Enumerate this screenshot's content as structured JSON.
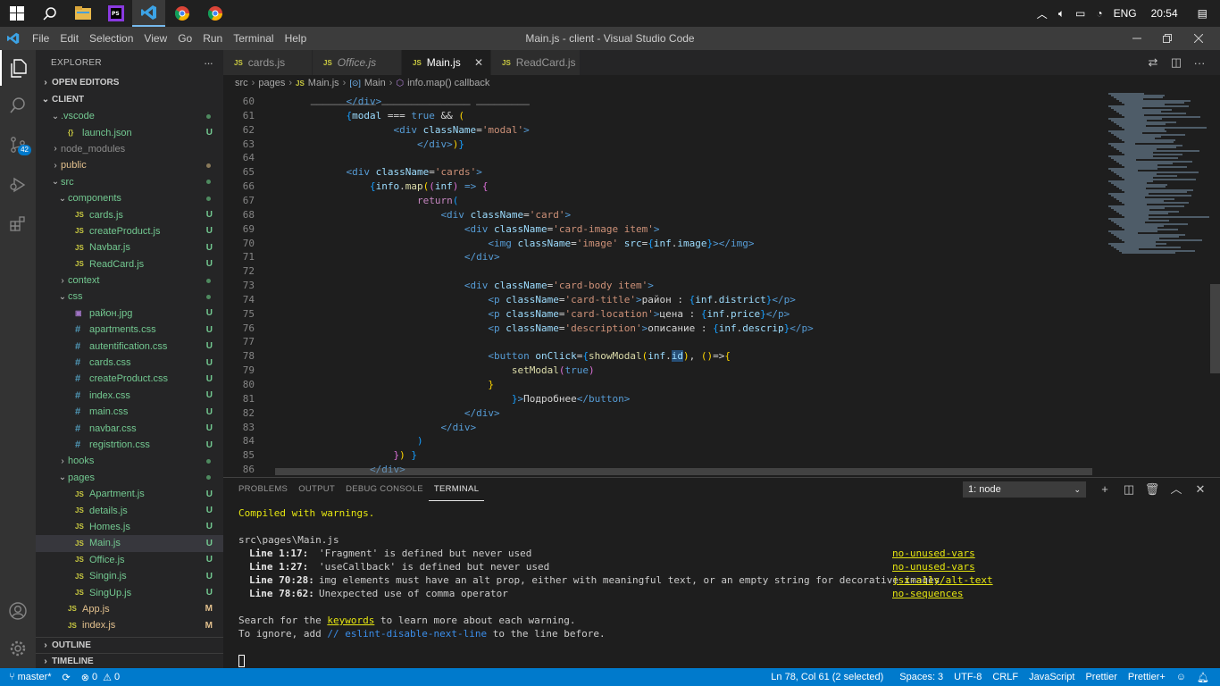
{
  "taskbar": {
    "language": "ENG",
    "time": "20:54"
  },
  "menu": {
    "items": [
      "File",
      "Edit",
      "Selection",
      "View",
      "Go",
      "Run",
      "Terminal",
      "Help"
    ],
    "window_title": "Main.js - client - Visual Studio Code"
  },
  "activity": {
    "scm_badge": "42"
  },
  "sidebar": {
    "title": "EXPLORER",
    "more": "···",
    "open_editors": "OPEN EDITORS",
    "root": "CLIENT",
    "tree": [
      {
        "label": ".vscode",
        "indent": 1,
        "kind": "folder-open",
        "status": "dot-g"
      },
      {
        "label": "launch.json",
        "indent": 2,
        "kind": "json",
        "status": "U"
      },
      {
        "label": "node_modules",
        "indent": 1,
        "kind": "folder",
        "status": ""
      },
      {
        "label": "public",
        "indent": 1,
        "kind": "folder",
        "status": "dot-m"
      },
      {
        "label": "src",
        "indent": 1,
        "kind": "folder-open",
        "status": "dot-g"
      },
      {
        "label": "components",
        "indent": 2,
        "kind": "folder-open",
        "status": "dot-g"
      },
      {
        "label": "cards.js",
        "indent": 3,
        "kind": "js",
        "status": "U"
      },
      {
        "label": "createProduct.js",
        "indent": 3,
        "kind": "js",
        "status": "U"
      },
      {
        "label": "Navbar.js",
        "indent": 3,
        "kind": "js",
        "status": "U"
      },
      {
        "label": "ReadCard.js",
        "indent": 3,
        "kind": "js",
        "status": "U"
      },
      {
        "label": "context",
        "indent": 2,
        "kind": "folder",
        "status": "dot-g"
      },
      {
        "label": "css",
        "indent": 2,
        "kind": "folder-open",
        "status": "dot-g"
      },
      {
        "label": "район.jpg",
        "indent": 3,
        "kind": "img",
        "status": "U"
      },
      {
        "label": "apartments.css",
        "indent": 3,
        "kind": "css",
        "status": "U"
      },
      {
        "label": "autentification.css",
        "indent": 3,
        "kind": "css",
        "status": "U"
      },
      {
        "label": "cards.css",
        "indent": 3,
        "kind": "css",
        "status": "U"
      },
      {
        "label": "createProduct.css",
        "indent": 3,
        "kind": "css",
        "status": "U"
      },
      {
        "label": "index.css",
        "indent": 3,
        "kind": "css",
        "status": "U"
      },
      {
        "label": "main.css",
        "indent": 3,
        "kind": "css",
        "status": "U"
      },
      {
        "label": "navbar.css",
        "indent": 3,
        "kind": "css",
        "status": "U"
      },
      {
        "label": "registrtion.css",
        "indent": 3,
        "kind": "css",
        "status": "U"
      },
      {
        "label": "hooks",
        "indent": 2,
        "kind": "folder",
        "status": "dot-g"
      },
      {
        "label": "pages",
        "indent": 2,
        "kind": "folder-open",
        "status": "dot-g"
      },
      {
        "label": "Apartment.js",
        "indent": 3,
        "kind": "js",
        "status": "U"
      },
      {
        "label": "details.js",
        "indent": 3,
        "kind": "js",
        "status": "U"
      },
      {
        "label": "Homes.js",
        "indent": 3,
        "kind": "js",
        "status": "U"
      },
      {
        "label": "Main.js",
        "indent": 3,
        "kind": "js",
        "status": "U",
        "selected": true
      },
      {
        "label": "Office.js",
        "indent": 3,
        "kind": "js",
        "status": "U"
      },
      {
        "label": "Singin.js",
        "indent": 3,
        "kind": "js",
        "status": "U"
      },
      {
        "label": "SingUp.js",
        "indent": 3,
        "kind": "js",
        "status": "U"
      },
      {
        "label": "App.js",
        "indent": 2,
        "kind": "js",
        "status": "M"
      },
      {
        "label": "index.js",
        "indent": 2,
        "kind": "js",
        "status": "M"
      }
    ],
    "outline": "OUTLINE",
    "timeline": "TIMELINE"
  },
  "tabs": [
    {
      "label": "cards.js",
      "active": false,
      "italic": false
    },
    {
      "label": "Office.js",
      "active": false,
      "italic": true
    },
    {
      "label": "Main.js",
      "active": true,
      "italic": false
    },
    {
      "label": "ReadCard.js",
      "active": false,
      "italic": false
    }
  ],
  "breadcrumb": [
    "src",
    "pages",
    "Main.js",
    "Main",
    "info.map() callback"
  ],
  "editor": {
    "lines": [
      {
        "n": "60",
        "html": "            <span class='tok-tag'>&lt;/div&gt;</span>"
      },
      {
        "n": "61",
        "html": "            <span class='tok-br3'>{</span><span class='tok-attr'>modal</span> === <span class='tok-tag'>true</span> &amp;&amp; <span class='tok-br'>(</span>"
      },
      {
        "n": "62",
        "html": "                    <span class='tok-tag'>&lt;div</span> <span class='tok-attr'>className</span>=<span class='tok-str'>'modal'</span><span class='tok-tag'>&gt;</span>"
      },
      {
        "n": "63",
        "html": "                        <span class='tok-tag'>&lt;/div&gt;</span><span class='tok-br'>)</span><span class='tok-br3'>}</span>"
      },
      {
        "n": "64",
        "html": ""
      },
      {
        "n": "65",
        "html": "            <span class='tok-tag'>&lt;div</span> <span class='tok-attr'>className</span>=<span class='tok-str'>'cards'</span><span class='tok-tag'>&gt;</span>"
      },
      {
        "n": "66",
        "html": "                <span class='tok-br3'>{</span><span class='tok-attr'>info</span>.<span class='tok-fn'>map</span><span class='tok-br'>(</span><span class='tok-br2'>(</span><span class='tok-attr'>inf</span><span class='tok-br2'>)</span> <span class='tok-tag'>=&gt;</span> <span class='tok-br2'>{</span>"
      },
      {
        "n": "67",
        "html": "                        <span class='tok-kw'>return</span><span class='tok-br3'>(</span>"
      },
      {
        "n": "68",
        "html": "                            <span class='tok-tag'>&lt;div</span> <span class='tok-attr'>className</span>=<span class='tok-str'>'card'</span><span class='tok-tag'>&gt;</span>"
      },
      {
        "n": "69",
        "html": "                                <span class='tok-tag'>&lt;div</span> <span class='tok-attr'>className</span>=<span class='tok-str'>'card-image item'</span><span class='tok-tag'>&gt;</span>"
      },
      {
        "n": "70",
        "html": "                                    <span class='tok-tag'>&lt;img</span> <span class='tok-attr'>className</span>=<span class='tok-str'>'image'</span> <span class='tok-attr'>src</span>=<span class='tok-br3'>{</span><span class='tok-attr'>inf</span>.<span class='tok-attr'>image</span><span class='tok-br3'>}</span><span class='tok-tag'>&gt;&lt;/img&gt;</span>"
      },
      {
        "n": "71",
        "html": "                                <span class='tok-tag'>&lt;/div&gt;</span>"
      },
      {
        "n": "72",
        "html": ""
      },
      {
        "n": "73",
        "html": "                                <span class='tok-tag'>&lt;div</span> <span class='tok-attr'>className</span>=<span class='tok-str'>'card-body item'</span><span class='tok-tag'>&gt;</span>"
      },
      {
        "n": "74",
        "html": "                                    <span class='tok-tag'>&lt;p</span> <span class='tok-attr'>className</span>=<span class='tok-str'>'card-title'</span><span class='tok-tag'>&gt;</span>район : <span class='tok-br3'>{</span><span class='tok-attr'>inf</span>.<span class='tok-attr'>district</span><span class='tok-br3'>}</span><span class='tok-tag'>&lt;/p&gt;</span>"
      },
      {
        "n": "75",
        "html": "                                    <span class='tok-tag'>&lt;p</span> <span class='tok-attr'>className</span>=<span class='tok-str'>'card-location'</span><span class='tok-tag'>&gt;</span>цена : <span class='tok-br3'>{</span><span class='tok-attr'>inf</span>.<span class='tok-attr'>price</span><span class='tok-br3'>}</span><span class='tok-tag'>&lt;/p&gt;</span>"
      },
      {
        "n": "76",
        "html": "                                    <span class='tok-tag'>&lt;p</span> <span class='tok-attr'>className</span>=<span class='tok-str'>'description'</span><span class='tok-tag'>&gt;</span>описание : <span class='tok-br3'>{</span><span class='tok-attr'>inf</span>.<span class='tok-attr'>descrip</span><span class='tok-br3'>}</span><span class='tok-tag'>&lt;/p&gt;</span>"
      },
      {
        "n": "77",
        "html": ""
      },
      {
        "n": "78",
        "html": "                                    <span class='tok-tag'>&lt;button</span> <span class='tok-attr'>onClick</span>=<span class='tok-br3'>{</span><span class='tok-fn'>showModal</span><span class='tok-br'>(</span><span class='tok-attr'>inf</span>.<span class='tok-attr' style='background:#264f78'>id</span><span class='tok-br'>)</span>, <span class='tok-br'>(</span><span class='tok-br'>)</span>=&gt;<span class='tok-br'>{</span>"
      },
      {
        "n": "79",
        "html": "                                        <span class='tok-fn'>setModal</span><span class='tok-br2'>(</span><span class='tok-tag'>true</span><span class='tok-br2'>)</span>"
      },
      {
        "n": "80",
        "html": "                                    <span class='tok-br'>}</span>"
      },
      {
        "n": "81",
        "html": "                                        <span class='tok-br3'>}</span><span class='tok-tag'>&gt;</span>Подробнее<span class='tok-tag'>&lt;/button&gt;</span>"
      },
      {
        "n": "82",
        "html": "                                <span class='tok-tag'>&lt;/div&gt;</span>"
      },
      {
        "n": "83",
        "html": "                            <span class='tok-tag'>&lt;/div&gt;</span>"
      },
      {
        "n": "84",
        "html": "                        <span class='tok-br3'>)</span>"
      },
      {
        "n": "85",
        "html": "                    <span class='tok-br2'>}</span><span class='tok-br'>)</span> <span class='tok-br3'>}</span>"
      },
      {
        "n": "86",
        "html": "                <span class='tok-tag'>&lt;/div&gt;</span>"
      }
    ]
  },
  "panel": {
    "tabs": [
      "PROBLEMS",
      "OUTPUT",
      "DEBUG CONSOLE",
      "TERMINAL"
    ],
    "active_tab": "TERMINAL",
    "terminal_select": "1: node",
    "terminal": {
      "compiled": "Compiled with warnings.",
      "file": "src\\pages\\Main.js",
      "warnings": [
        {
          "loc": "Line 1:17:",
          "msg": "'Fragment' is defined but never used",
          "rule": "no-unused-vars"
        },
        {
          "loc": "Line 1:27:",
          "msg": "'useCallback' is defined but never used",
          "rule": "no-unused-vars"
        },
        {
          "loc": "Line 70:28:",
          "msg": "img elements must have an alt prop, either with meaningful text, or an empty string for decorative images",
          "rule": "jsx-a11y/alt-text"
        },
        {
          "loc": "Line 78:62:",
          "msg": "Unexpected use of comma operator",
          "rule": "no-sequences"
        }
      ],
      "search_pre": "Search for the ",
      "search_kw": "keywords",
      "search_post": " to learn more about each warning.",
      "ignore_pre": "To ignore, add ",
      "ignore_kw": "// eslint-disable-next-line",
      "ignore_post": " to the line before."
    }
  },
  "status": {
    "branch": "master*",
    "errors": "0",
    "warnings": "0",
    "position": "Ln 78, Col 61 (2 selected)",
    "spaces": "Spaces: 3",
    "encoding": "UTF-8",
    "eol": "CRLF",
    "language": "JavaScript",
    "prettier": "Prettier",
    "prettier_plus": "Prettier+"
  },
  "colors": {
    "accent": "#007acc",
    "untracked": "#73c991",
    "modified": "#e2c08d",
    "js_icon": "#cbcb41"
  }
}
